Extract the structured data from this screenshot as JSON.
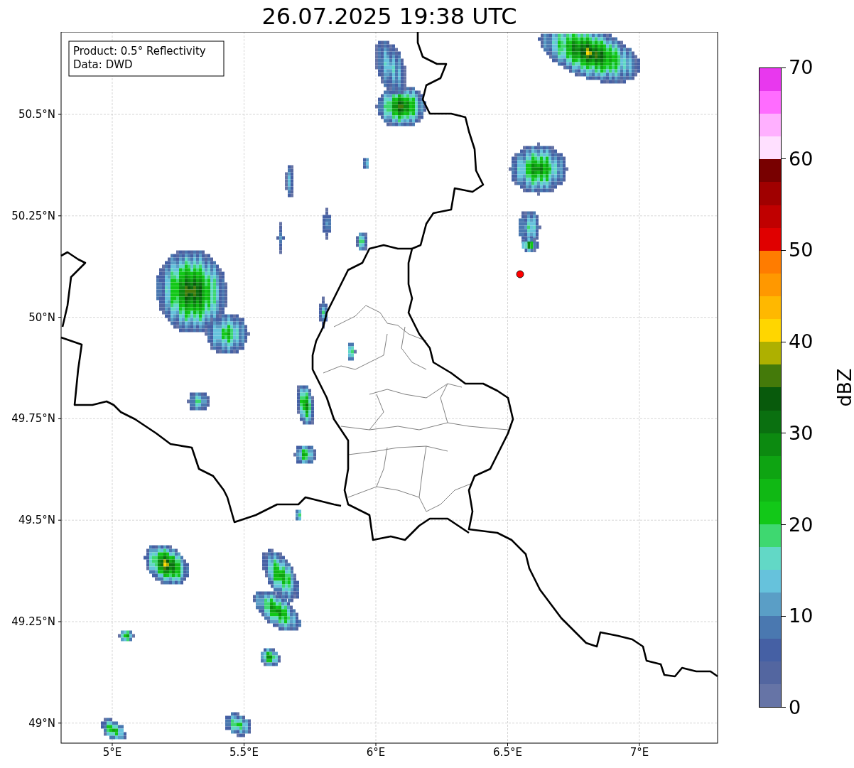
{
  "title": "26.07.2025 19:38 UTC",
  "info_box": {
    "lines": [
      "Product: 0.5° Reflectivity",
      "Data: DWD"
    ]
  },
  "map": {
    "x_ticks": [
      "5°E",
      "5.5°E",
      "6°E",
      "6.5°E",
      "7°E"
    ],
    "y_ticks": [
      "50.5°N",
      "50.25°N",
      "50°N",
      "49.75°N",
      "49.5°N",
      "49.25°N",
      "49°N"
    ]
  },
  "colorbar": {
    "label": "dBZ",
    "ticks": [
      "70",
      "60",
      "50",
      "40",
      "30",
      "20",
      "10",
      "0"
    ],
    "bands": [
      {
        "color": "#6674a6"
      },
      {
        "color": "#5366a0"
      },
      {
        "color": "#4560a4"
      },
      {
        "color": "#4a78b0"
      },
      {
        "color": "#5a9ec6"
      },
      {
        "color": "#66c2dc"
      },
      {
        "color": "#62d8c6"
      },
      {
        "color": "#3ed870"
      },
      {
        "color": "#12c818"
      },
      {
        "color": "#10b814"
      },
      {
        "color": "#0ea412"
      },
      {
        "color": "#0c8a10"
      },
      {
        "color": "#0a7010"
      },
      {
        "color": "#085a0c"
      },
      {
        "color": "#447a0a"
      },
      {
        "color": "#aeb000"
      },
      {
        "color": "#ffd600"
      },
      {
        "color": "#ffb800"
      },
      {
        "color": "#ff9800"
      },
      {
        "color": "#ff7c00"
      },
      {
        "color": "#e00000"
      },
      {
        "color": "#c00000"
      },
      {
        "color": "#a00000"
      },
      {
        "color": "#780000"
      },
      {
        "color": "#ffe0ff"
      },
      {
        "color": "#ffb0ff"
      },
      {
        "color": "#ff6cff"
      },
      {
        "color": "#e838ee"
      }
    ]
  }
}
